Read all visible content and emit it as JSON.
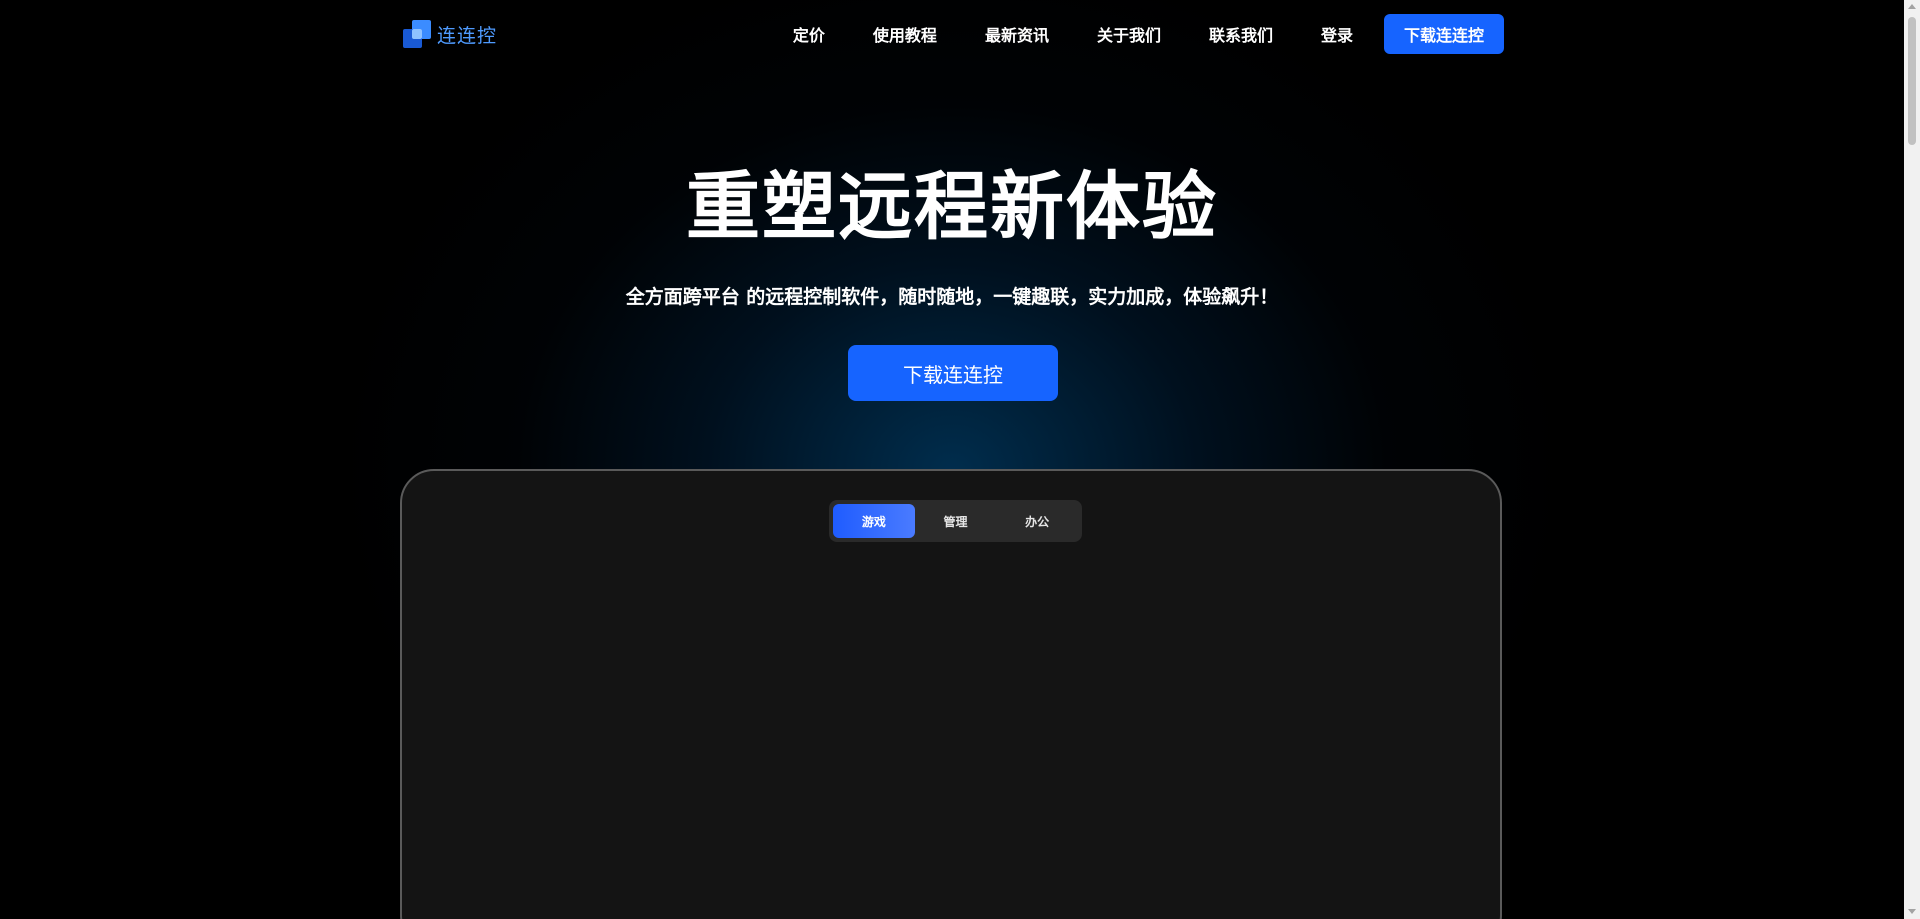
{
  "brand": {
    "name": "连连控",
    "color": "#4f9bff"
  },
  "nav": {
    "items": [
      {
        "label": "定价"
      },
      {
        "label": "使用教程"
      },
      {
        "label": "最新资讯"
      },
      {
        "label": "关于我们"
      },
      {
        "label": "联系我们"
      },
      {
        "label": "登录"
      }
    ],
    "download_label": "下载连连控"
  },
  "hero": {
    "title": "重塑远程新体验",
    "subtitle": "全方面跨平台 的远程控制软件，随时随地，一键趣联，实力加成，体验飙升！",
    "download_label": "下载连连控"
  },
  "showcase": {
    "tabs": [
      {
        "label": "游戏",
        "active": true
      },
      {
        "label": "管理",
        "active": false
      },
      {
        "label": "办公",
        "active": false
      }
    ]
  },
  "colors": {
    "accent": "#1664ff",
    "background": "#000000",
    "frame": "#141414"
  }
}
